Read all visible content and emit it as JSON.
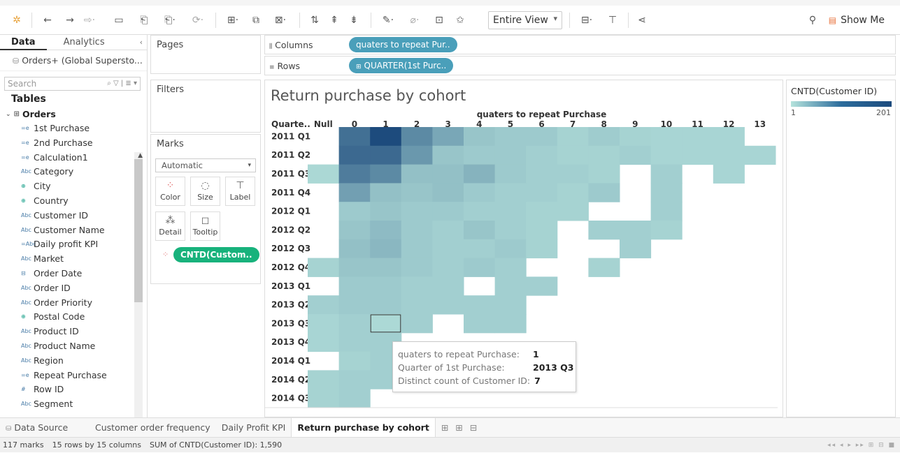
{
  "toolbar": {
    "view_mode": "Entire View",
    "show_me": "Show Me",
    "icons": [
      "tableau-logo-icon",
      "undo-icon",
      "redo-icon",
      "redo-replay-icon",
      "save-icon",
      "new-datasource-icon",
      "pause-icon",
      "refresh-icon",
      "new-worksheet-icon",
      "duplicate-icon",
      "clear-icon",
      "swap-icon",
      "sort-asc-icon",
      "sort-desc-icon",
      "highlight-icon",
      "group-icon",
      "label-icon",
      "pin-icon",
      "fit-icon",
      "presentation-icon",
      "share-icon",
      "pin-panel-icon",
      "show-me-icon"
    ]
  },
  "data_pane": {
    "tab_data": "Data",
    "tab_analytics": "Analytics",
    "source": "Orders+ (Global Supersto...",
    "search_placeholder": "Search",
    "tables_heading": "Tables",
    "group": "Orders",
    "fields": [
      {
        "icon": "=e",
        "label": "1st Purchase",
        "kind": "dim"
      },
      {
        "icon": "=e",
        "label": "2nd Purchase",
        "kind": "dim"
      },
      {
        "icon": "=e",
        "label": "Calculation1",
        "kind": "dim"
      },
      {
        "icon": "Abc",
        "label": "Category",
        "kind": "dim"
      },
      {
        "icon": "⊕",
        "label": "City",
        "kind": "geo"
      },
      {
        "icon": "⊕",
        "label": "Country",
        "kind": "geo"
      },
      {
        "icon": "Abc",
        "label": "Customer ID",
        "kind": "dim"
      },
      {
        "icon": "Abc",
        "label": "Customer Name",
        "kind": "dim"
      },
      {
        "icon": "=Abc",
        "label": "Daily profit KPI",
        "kind": "dim"
      },
      {
        "icon": "Abc",
        "label": "Market",
        "kind": "dim"
      },
      {
        "icon": "⊟",
        "label": "Order Date",
        "kind": "dim"
      },
      {
        "icon": "Abc",
        "label": "Order ID",
        "kind": "dim"
      },
      {
        "icon": "Abc",
        "label": "Order Priority",
        "kind": "dim"
      },
      {
        "icon": "⊕",
        "label": "Postal Code",
        "kind": "geo"
      },
      {
        "icon": "Abc",
        "label": "Product ID",
        "kind": "dim"
      },
      {
        "icon": "Abc",
        "label": "Product Name",
        "kind": "dim"
      },
      {
        "icon": "Abc",
        "label": "Region",
        "kind": "dim"
      },
      {
        "icon": "=e",
        "label": "Repeat Purchase",
        "kind": "dim"
      },
      {
        "icon": "#",
        "label": "Row ID",
        "kind": "measure"
      },
      {
        "icon": "Abc",
        "label": "Segment",
        "kind": "dim"
      }
    ]
  },
  "shelves": {
    "pages": "Pages",
    "filters": "Filters",
    "marks": "Marks",
    "mark_type": "Automatic",
    "buttons": [
      "Color",
      "Size",
      "Label",
      "Detail",
      "Tooltip"
    ],
    "marks_pill": "CNTD(Custom..",
    "columns_label": "Columns",
    "columns_pill": "quaters to repeat Pur..",
    "rows_label": "Rows",
    "rows_pill": "QUARTER(1st Purc.."
  },
  "chart_data": {
    "type": "heatmap",
    "title": "Return purchase by cohort",
    "xlabel": "quaters to repeat Purchase",
    "row_header": "Quarte..",
    "columns": [
      "Null",
      "0",
      "1",
      "2",
      "3",
      "4",
      "5",
      "6",
      "7",
      "8",
      "9",
      "10",
      "11",
      "12",
      "13"
    ],
    "rows": [
      "2011 Q1",
      "2011 Q2",
      "2011 Q3",
      "2011 Q4",
      "2012 Q1",
      "2012 Q2",
      "2012 Q3",
      "2012 Q4",
      "2013 Q1",
      "2013 Q2",
      "2013 Q3",
      "2013 Q4",
      "2014 Q1",
      "2014 Q2",
      "2014 Q3"
    ],
    "values": [
      [
        null,
        140,
        201,
        100,
        60,
        25,
        20,
        20,
        12,
        18,
        12,
        10,
        10,
        10,
        null
      ],
      [
        null,
        150,
        150,
        80,
        25,
        20,
        20,
        15,
        12,
        12,
        15,
        10,
        10,
        10,
        10
      ],
      [
        8,
        120,
        100,
        30,
        30,
        45,
        20,
        15,
        15,
        12,
        null,
        15,
        null,
        10,
        null
      ],
      [
        null,
        70,
        30,
        25,
        30,
        20,
        15,
        15,
        12,
        20,
        null,
        15,
        null,
        null,
        null
      ],
      [
        null,
        20,
        25,
        20,
        20,
        15,
        15,
        12,
        12,
        null,
        null,
        15,
        null,
        null,
        null
      ],
      [
        null,
        25,
        35,
        20,
        15,
        25,
        15,
        12,
        null,
        15,
        15,
        12,
        null,
        null,
        null
      ],
      [
        null,
        30,
        40,
        20,
        15,
        15,
        20,
        12,
        null,
        null,
        15,
        null,
        null,
        null,
        null
      ],
      [
        12,
        25,
        25,
        20,
        15,
        20,
        15,
        null,
        null,
        12,
        null,
        null,
        null,
        null,
        null
      ],
      [
        null,
        20,
        20,
        15,
        15,
        null,
        15,
        15,
        null,
        null,
        null,
        null,
        null,
        null,
        null
      ],
      [
        15,
        20,
        20,
        15,
        15,
        15,
        15,
        null,
        null,
        null,
        null,
        null,
        null,
        null,
        null
      ],
      [
        10,
        15,
        7,
        15,
        null,
        15,
        15,
        null,
        null,
        null,
        null,
        null,
        null,
        null,
        null
      ],
      [
        10,
        15,
        15,
        null,
        null,
        null,
        null,
        null,
        null,
        null,
        null,
        null,
        null,
        null,
        null
      ],
      [
        null,
        12,
        15,
        null,
        null,
        null,
        null,
        null,
        null,
        null,
        null,
        null,
        null,
        null,
        null
      ],
      [
        12,
        15,
        15,
        null,
        null,
        null,
        null,
        null,
        null,
        null,
        null,
        null,
        null,
        null,
        null
      ],
      [
        12,
        15,
        null,
        null,
        null,
        null,
        null,
        null,
        null,
        null,
        null,
        null,
        null,
        null,
        null
      ]
    ],
    "color_range": [
      1,
      201
    ],
    "color_low": "#b7e4dd",
    "color_high": "#1d4b7d",
    "selected": {
      "row": "2013 Q3",
      "col": "1"
    }
  },
  "legend": {
    "title": "CNTD(Customer ID)",
    "min": "1",
    "max": "201"
  },
  "tooltip": {
    "rows": [
      {
        "k": "quaters to repeat Purchase:",
        "v": "1"
      },
      {
        "k": "Quarter of 1st Purchase:",
        "v": "2013 Q3"
      },
      {
        "k": "Distinct count of Customer ID:",
        "v": "7"
      }
    ]
  },
  "sheet_tabs": {
    "data_source": "Data Source",
    "tabs": [
      "Customer order frequency",
      "Daily Profit KPI",
      "Return purchase by cohort"
    ],
    "active": "Return purchase by cohort"
  },
  "status": {
    "marks": "117 marks",
    "dims": "15 rows by 15 columns",
    "sum": "SUM of CNTD(Customer ID): 1,590"
  }
}
